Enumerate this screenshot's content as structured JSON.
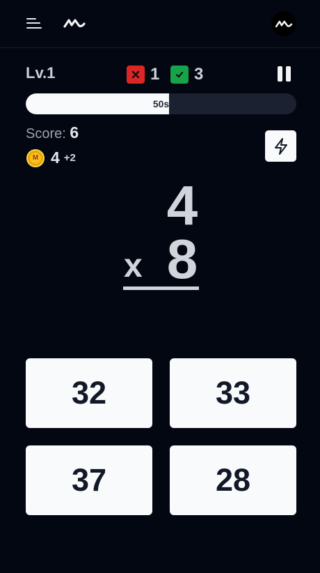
{
  "header": {
    "menu_icon": "menu-icon",
    "logo_icon": "squiggle-logo-icon",
    "avatar_icon": "squiggle-logo-icon"
  },
  "status": {
    "level": "Lv.1",
    "wrong_count": "1",
    "correct_count": "3",
    "wrong_color": "#dc2626",
    "correct_color": "#16a34a"
  },
  "timer": {
    "label": "50s",
    "remaining_fraction": 0.53
  },
  "score": {
    "label": "Score:",
    "value": "6"
  },
  "coins": {
    "count": "4",
    "bonus": "+2",
    "coin_letter": "M"
  },
  "problem": {
    "top": "4",
    "operator": "x",
    "bottom": "8"
  },
  "answers": [
    {
      "label": "32"
    },
    {
      "label": "33"
    },
    {
      "label": "37"
    },
    {
      "label": "28"
    }
  ]
}
